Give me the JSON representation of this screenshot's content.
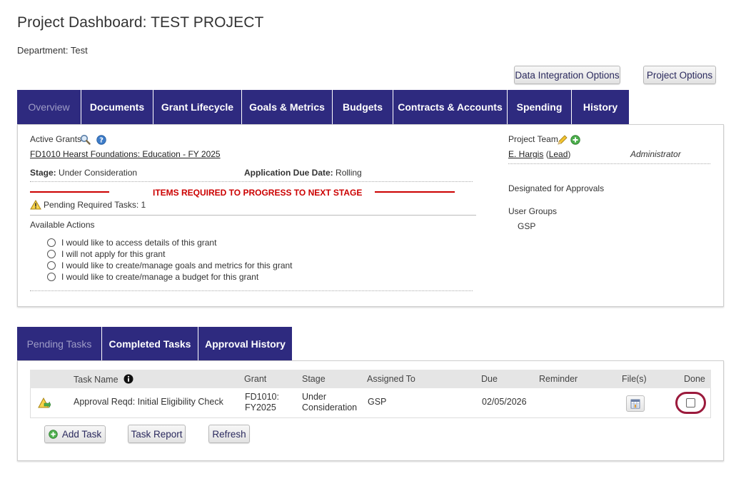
{
  "page": {
    "title": "Project Dashboard: TEST PROJECT",
    "department": "Department: Test"
  },
  "top_buttons": {
    "data_integration": "Data Integration Options",
    "project_options": "Project Options"
  },
  "tabs": [
    {
      "label": "Overview",
      "active": true
    },
    {
      "label": "Documents"
    },
    {
      "label": "Grant Lifecycle"
    },
    {
      "label": "Goals & Metrics"
    },
    {
      "label": "Budgets"
    },
    {
      "label": "Contracts & Accounts"
    },
    {
      "label": "Spending"
    },
    {
      "label": "History"
    }
  ],
  "overview": {
    "active_grants_label": "Active Grants",
    "grant_link": "FD1010 Hearst Foundations: Education - FY 2025",
    "stage_label": "Stage:",
    "stage_value": "Under Consideration",
    "due_label": "Application Due Date:",
    "due_value": "Rolling",
    "items_required": "ITEMS REQUIRED TO PROGRESS TO NEXT STAGE",
    "pending_required": "Pending Required Tasks: 1",
    "available_actions_label": "Available Actions",
    "actions": [
      "I would like to access details of this grant",
      "I will not apply for this grant",
      "I would like to create/manage goals and metrics for this grant",
      "I would like to create/manage a budget for this grant"
    ],
    "project_team_label": "Project Team",
    "member_name": "E. Hargis",
    "member_lead": "Lead",
    "member_role": "Administrator",
    "designated_label": "Designated for Approvals",
    "user_groups_label": "User Groups",
    "user_group": "GSP"
  },
  "task_tabs": [
    {
      "label": "Pending Tasks",
      "active": true
    },
    {
      "label": "Completed Tasks"
    },
    {
      "label": "Approval History"
    }
  ],
  "task_table": {
    "headers": [
      "Task Name",
      "Grant",
      "Stage",
      "Assigned To",
      "Due",
      "Reminder",
      "File(s)",
      "Done"
    ],
    "row": {
      "task_name": "Approval Reqd: Initial Eligibility Check",
      "grant_line1": "FD1010:",
      "grant_line2": "FY2025",
      "stage_line1": "Under",
      "stage_line2": "Consideration",
      "assigned_to": "GSP",
      "due": "02/05/2026",
      "reminder": "",
      "done": false
    }
  },
  "task_buttons": {
    "add_task": "Add Task",
    "task_report": "Task Report",
    "refresh": "Refresh"
  },
  "colors": {
    "tab_bg": "#2e2a7f",
    "alert_red": "#cc0000",
    "highlight_ring": "#9b1a3c"
  }
}
